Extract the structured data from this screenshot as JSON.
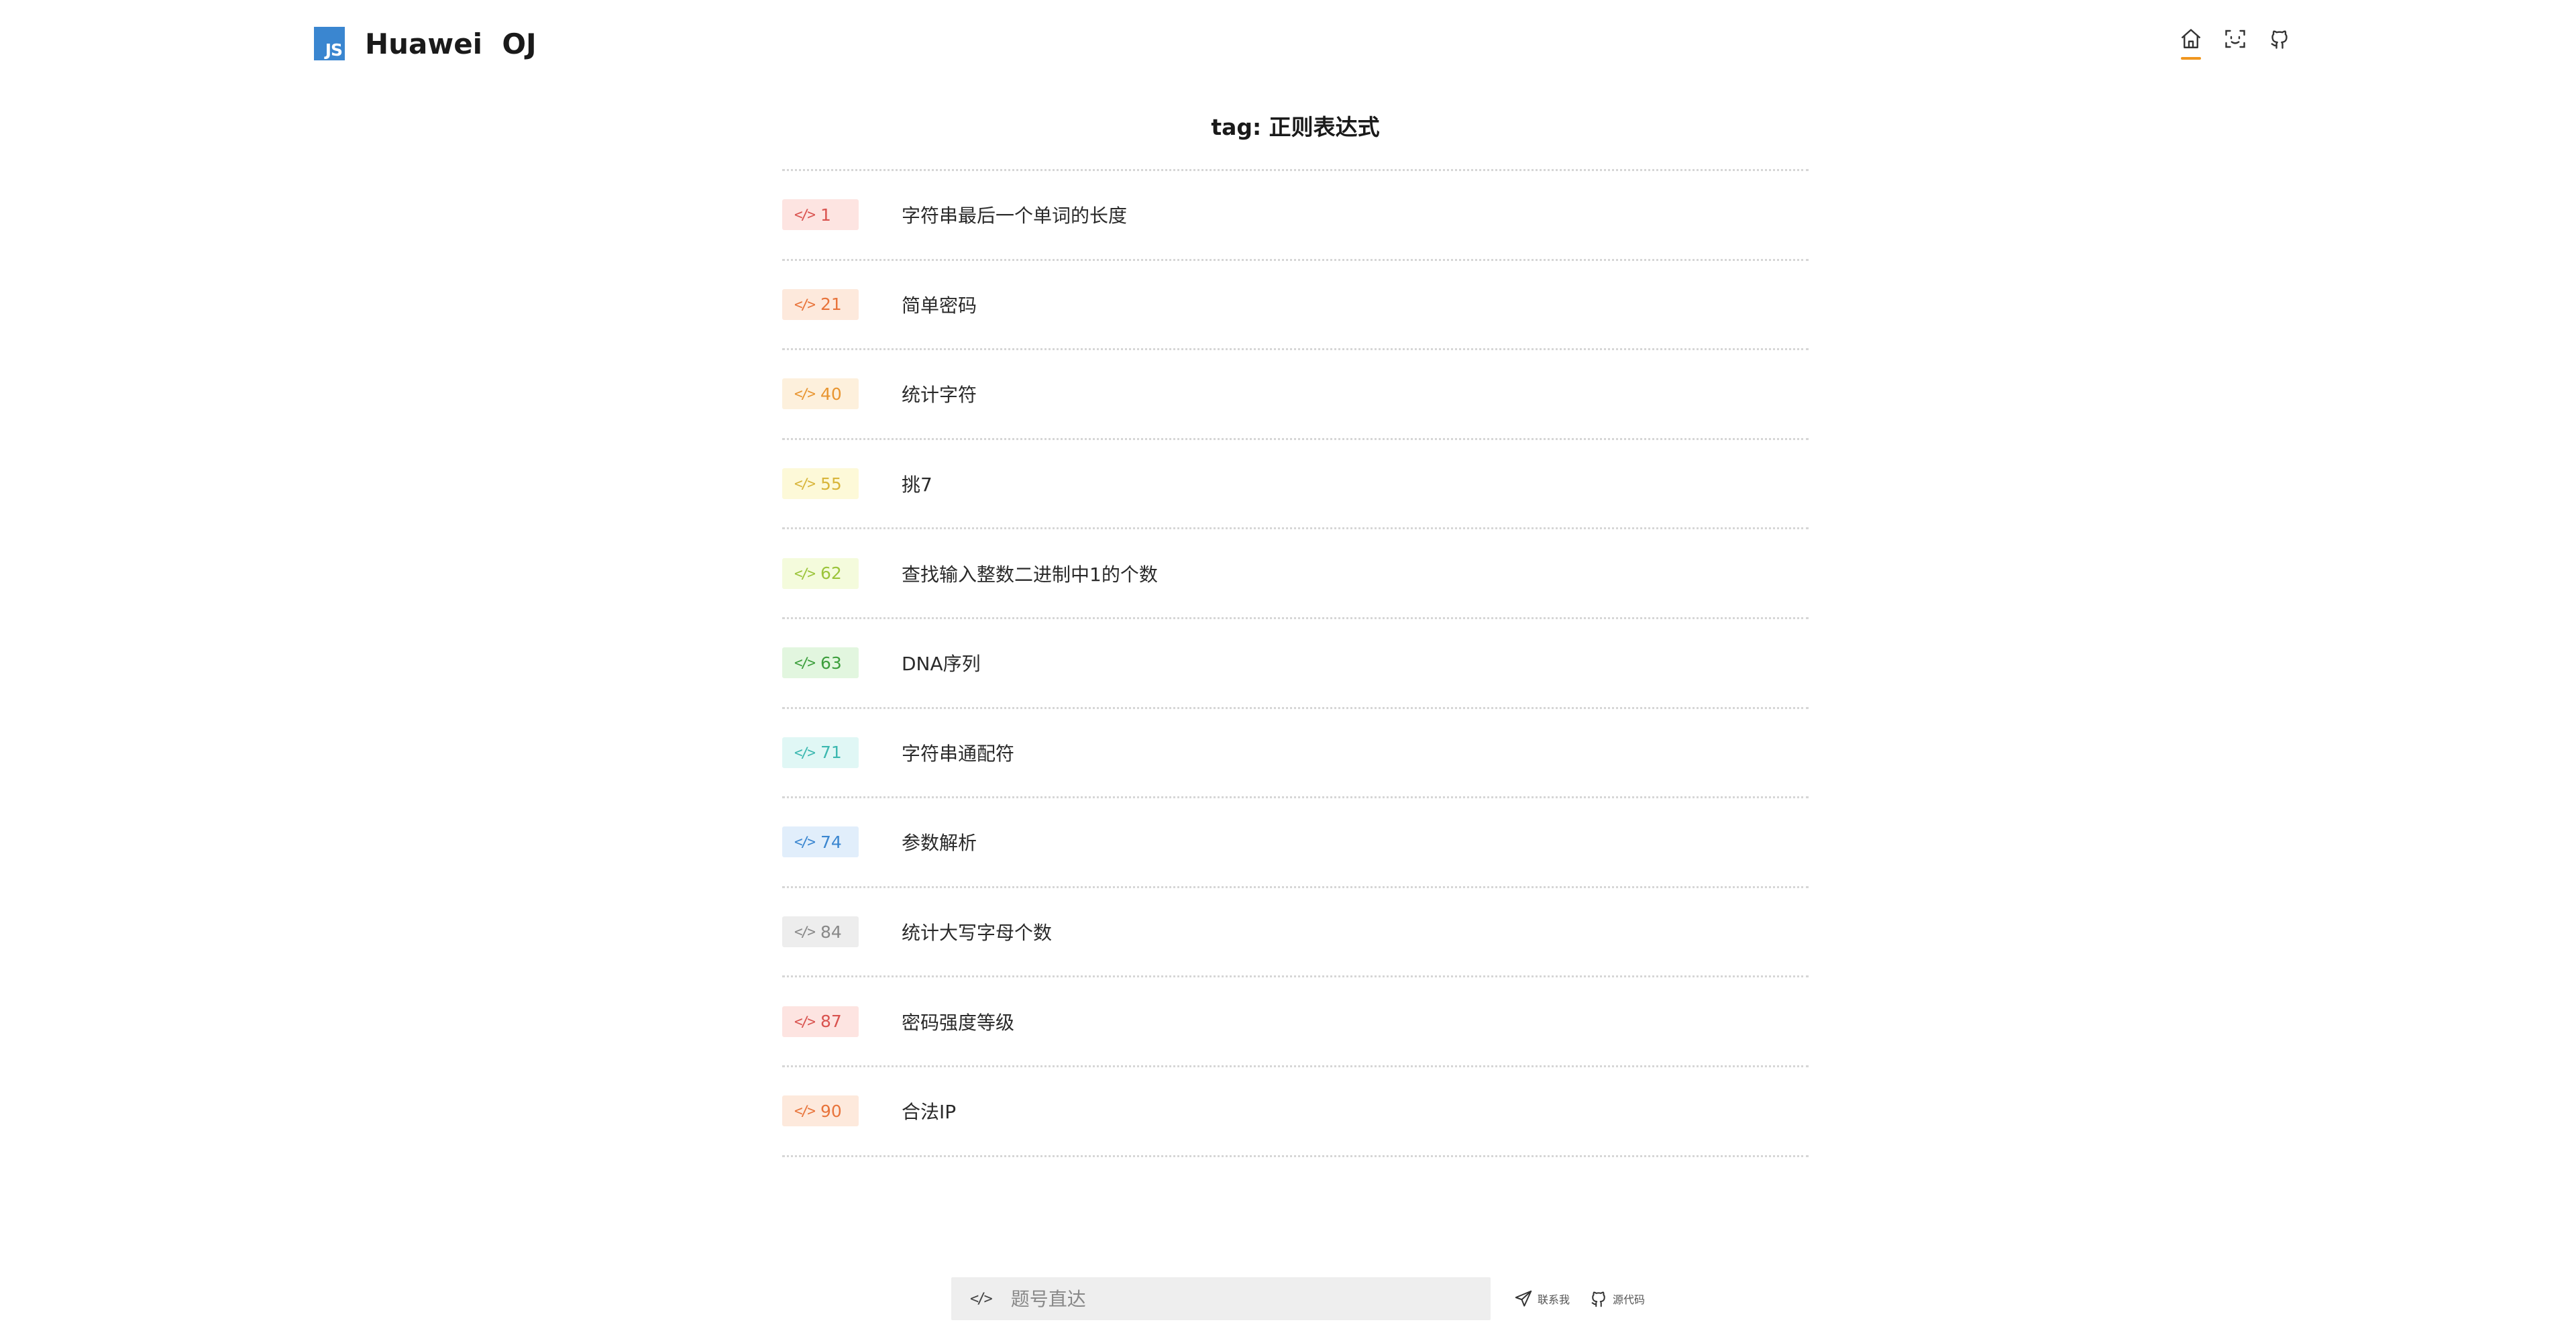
{
  "header": {
    "logo_text": "JS",
    "title": "Huawei  OJ",
    "nav_icons": [
      {
        "icon": "home-icon",
        "active": true
      },
      {
        "icon": "scan-icon",
        "active": false
      },
      {
        "icon": "github-icon",
        "active": false
      }
    ]
  },
  "main": {
    "title": "tag: 正则表达式",
    "problems": [
      {
        "id": "1",
        "title": "字符串最后一个单词的长度",
        "badge_bg": "#fde4e1",
        "badge_fg": "#d9534f"
      },
      {
        "id": "21",
        "title": "简单密码",
        "badge_bg": "#fde9dc",
        "badge_fg": "#e8743b"
      },
      {
        "id": "40",
        "title": "统计字符",
        "badge_bg": "#fdf0dc",
        "badge_fg": "#e89530"
      },
      {
        "id": "55",
        "title": "挑7",
        "badge_bg": "#fdf9d8",
        "badge_fg": "#d8b53a"
      },
      {
        "id": "62",
        "title": "查找输入整数二进制中1的个数",
        "badge_bg": "#f4fbdc",
        "badge_fg": "#9bc43a"
      },
      {
        "id": "63",
        "title": "DNA序列",
        "badge_bg": "#e2f6df",
        "badge_fg": "#3c9e3c"
      },
      {
        "id": "71",
        "title": "字符串通配符",
        "badge_bg": "#e0f7f5",
        "badge_fg": "#3cb8b0"
      },
      {
        "id": "74",
        "title": "参数解析",
        "badge_bg": "#e1eefb",
        "badge_fg": "#3a86d0"
      },
      {
        "id": "84",
        "title": "统计大写字母个数",
        "badge_bg": "#ededed",
        "badge_fg": "#888888"
      },
      {
        "id": "87",
        "title": "密码强度等级",
        "badge_bg": "#fde4e1",
        "badge_fg": "#d9534f"
      },
      {
        "id": "90",
        "title": "合法IP",
        "badge_bg": "#fde9dc",
        "badge_fg": "#e8743b"
      }
    ]
  },
  "footer": {
    "jump_placeholder": "题号直达",
    "contact_label": "联系我",
    "source_label": "源代码"
  }
}
